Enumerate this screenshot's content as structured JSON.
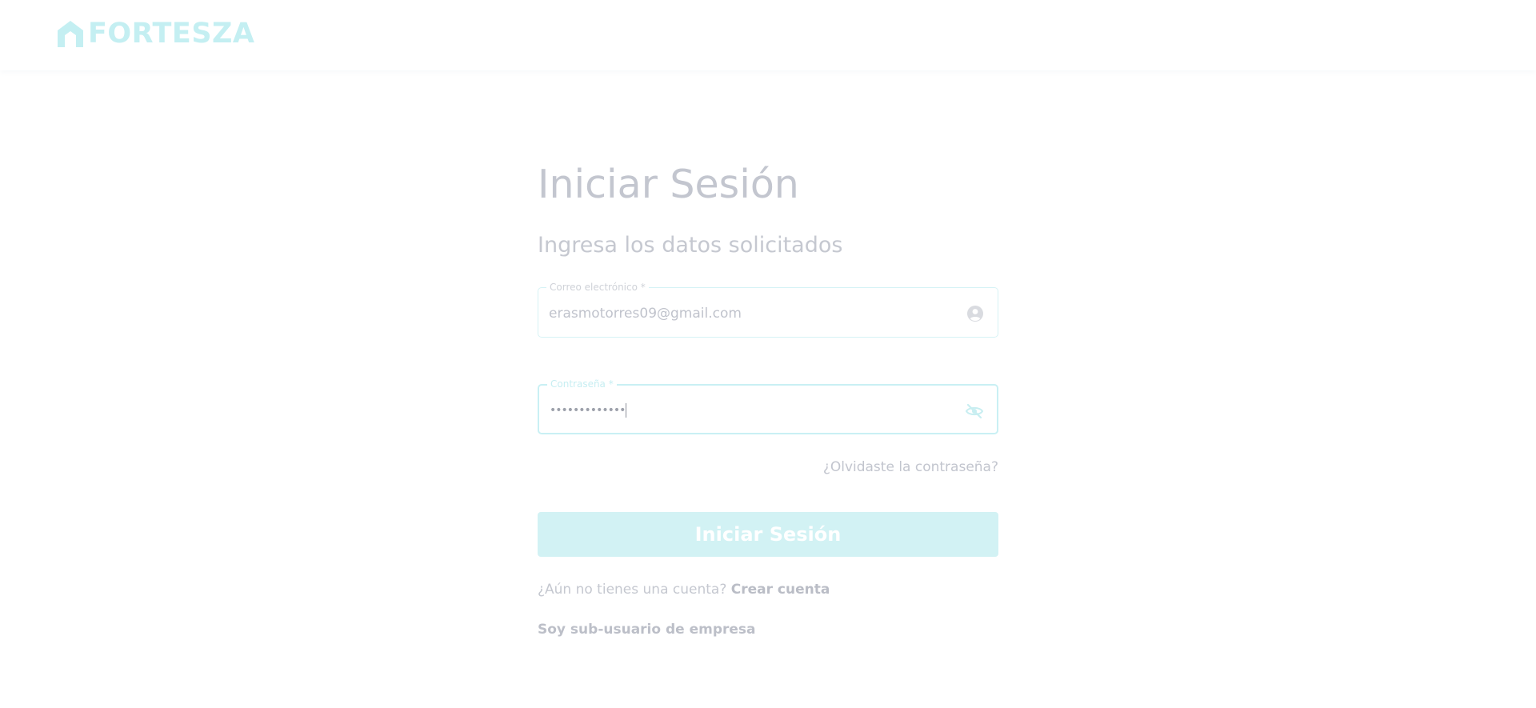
{
  "header": {
    "logo_text": "FORTESZA",
    "logo_icon": "house-icon",
    "brand_color": "#c4eff2"
  },
  "login": {
    "title": "Iniciar Sesión",
    "subtitle": "Ingresa los datos solicitados",
    "email": {
      "label": "Correo electrónico *",
      "value": "erasmotorres09@gmail.com",
      "icon": "account-circle-icon"
    },
    "password": {
      "label": "Contraseña *",
      "value": "•••••••••••••",
      "icon": "eye-off-icon"
    },
    "forgot_label": "¿Olvidaste la contraseña?",
    "submit_label": "Iniciar Sesión",
    "signup_prompt": "¿Aún no tienes una cuenta?",
    "signup_link": "Crear cuenta",
    "subuser_link": "Soy sub-usuario de empresa"
  }
}
